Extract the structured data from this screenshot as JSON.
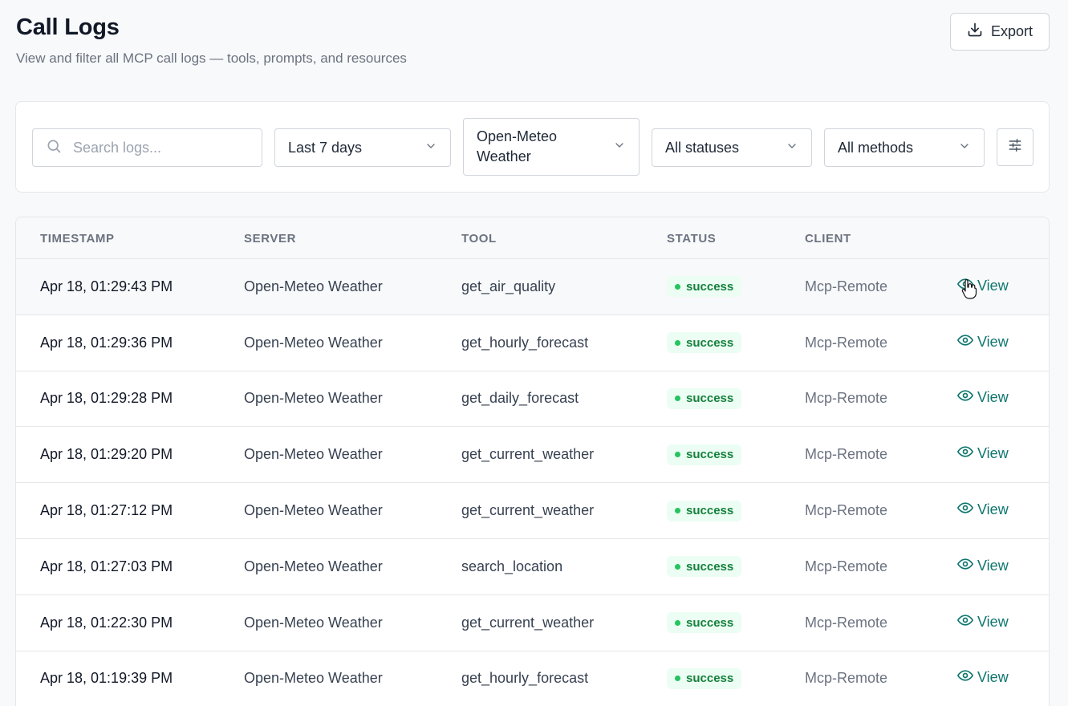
{
  "header": {
    "title": "Call Logs",
    "subtitle": "View and filter all MCP call logs — tools, prompts, and resources",
    "export_label": "Export"
  },
  "filters": {
    "search_placeholder": "Search logs...",
    "date_range": "Last 7 days",
    "server": "Open-Meteo Weather",
    "status": "All statuses",
    "method": "All methods"
  },
  "icons": {
    "export": "download-icon",
    "search": "search-icon",
    "select": "chevron-down-icon",
    "advanced": "sliders-icon",
    "view": "eye-icon"
  },
  "colors": {
    "accent": "#0f766e",
    "success_text": "#15803d",
    "success_bg": "#ecfdf3",
    "success_dot": "#22c55e"
  },
  "table": {
    "columns": [
      "TIMESTAMP",
      "SERVER",
      "TOOL",
      "STATUS",
      "CLIENT"
    ],
    "action_label": "View",
    "rows": [
      {
        "timestamp": "Apr 18, 01:29:43 PM",
        "server": "Open-Meteo Weather",
        "tool": "get_air_quality",
        "status": "success",
        "client": "Mcp-Remote"
      },
      {
        "timestamp": "Apr 18, 01:29:36 PM",
        "server": "Open-Meteo Weather",
        "tool": "get_hourly_forecast",
        "status": "success",
        "client": "Mcp-Remote"
      },
      {
        "timestamp": "Apr 18, 01:29:28 PM",
        "server": "Open-Meteo Weather",
        "tool": "get_daily_forecast",
        "status": "success",
        "client": "Mcp-Remote"
      },
      {
        "timestamp": "Apr 18, 01:29:20 PM",
        "server": "Open-Meteo Weather",
        "tool": "get_current_weather",
        "status": "success",
        "client": "Mcp-Remote"
      },
      {
        "timestamp": "Apr 18, 01:27:12 PM",
        "server": "Open-Meteo Weather",
        "tool": "get_current_weather",
        "status": "success",
        "client": "Mcp-Remote"
      },
      {
        "timestamp": "Apr 18, 01:27:03 PM",
        "server": "Open-Meteo Weather",
        "tool": "search_location",
        "status": "success",
        "client": "Mcp-Remote"
      },
      {
        "timestamp": "Apr 18, 01:22:30 PM",
        "server": "Open-Meteo Weather",
        "tool": "get_current_weather",
        "status": "success",
        "client": "Mcp-Remote"
      },
      {
        "timestamp": "Apr 18, 01:19:39 PM",
        "server": "Open-Meteo Weather",
        "tool": "get_hourly_forecast",
        "status": "success",
        "client": "Mcp-Remote"
      }
    ]
  }
}
